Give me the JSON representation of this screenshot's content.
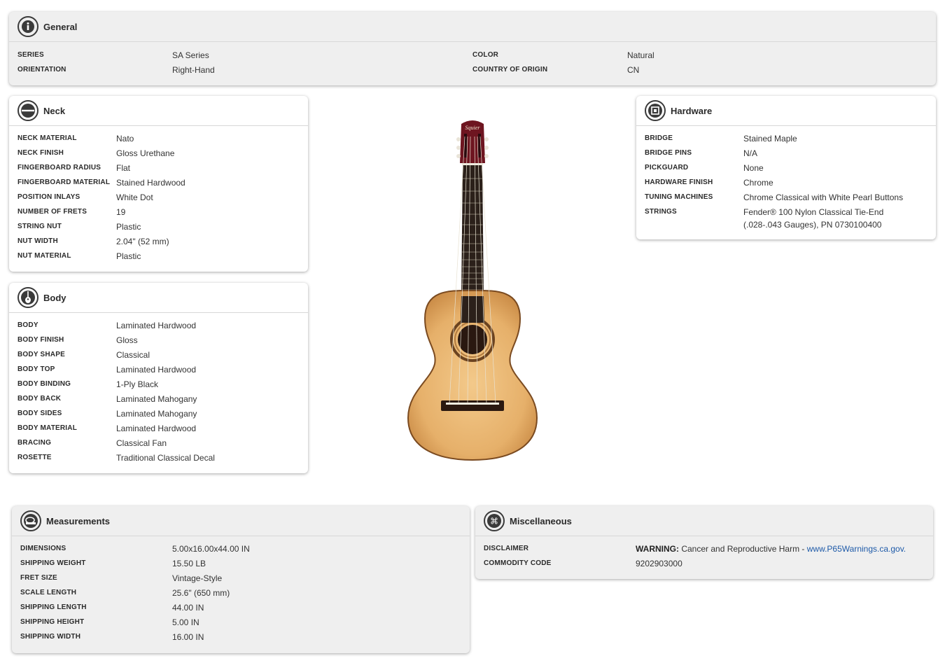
{
  "general": {
    "title": "General",
    "rows_left": [
      {
        "label": "SERIES",
        "value": "SA Series"
      },
      {
        "label": "ORIENTATION",
        "value": "Right-Hand"
      }
    ],
    "rows_right": [
      {
        "label": "COLOR",
        "value": "Natural"
      },
      {
        "label": "COUNTRY OF ORIGIN",
        "value": "CN"
      }
    ]
  },
  "neck": {
    "title": "Neck",
    "rows": [
      {
        "label": "NECK MATERIAL",
        "value": "Nato"
      },
      {
        "label": "NECK FINISH",
        "value": "Gloss Urethane"
      },
      {
        "label": "FINGERBOARD RADIUS",
        "value": "Flat"
      },
      {
        "label": "FINGERBOARD MATERIAL",
        "value": "Stained Hardwood"
      },
      {
        "label": "POSITION INLAYS",
        "value": "White Dot"
      },
      {
        "label": "NUMBER OF FRETS",
        "value": "19"
      },
      {
        "label": "STRING NUT",
        "value": "Plastic"
      },
      {
        "label": "NUT WIDTH",
        "value": "2.04\" (52 mm)"
      },
      {
        "label": "NUT MATERIAL",
        "value": "Plastic"
      }
    ]
  },
  "body": {
    "title": "Body",
    "rows": [
      {
        "label": "BODY",
        "value": "Laminated Hardwood"
      },
      {
        "label": "BODY FINISH",
        "value": "Gloss"
      },
      {
        "label": "BODY SHAPE",
        "value": "Classical"
      },
      {
        "label": "BODY TOP",
        "value": "Laminated Hardwood"
      },
      {
        "label": "BODY BINDING",
        "value": "1-Ply Black"
      },
      {
        "label": "BODY BACK",
        "value": "Laminated Mahogany"
      },
      {
        "label": "BODY SIDES",
        "value": "Laminated Mahogany"
      },
      {
        "label": "BODY MATERIAL",
        "value": "Laminated Hardwood"
      },
      {
        "label": "BRACING",
        "value": "Classical Fan"
      },
      {
        "label": "ROSETTE",
        "value": "Traditional Classical Decal"
      }
    ]
  },
  "hardware": {
    "title": "Hardware",
    "rows": [
      {
        "label": "BRIDGE",
        "value": "Stained Maple"
      },
      {
        "label": "BRIDGE PINS",
        "value": "N/A"
      },
      {
        "label": "PICKGUARD",
        "value": "None"
      },
      {
        "label": "HARDWARE FINISH",
        "value": "Chrome"
      },
      {
        "label": "TUNING MACHINES",
        "value": "Chrome Classical with White Pearl Buttons"
      },
      {
        "label": "STRINGS",
        "value": "Fender® 100 Nylon Classical Tie-End (.028-.043 Gauges), PN 0730100400"
      }
    ]
  },
  "measurements": {
    "title": "Measurements",
    "rows": [
      {
        "label": "DIMENSIONS",
        "value": "5.00x16.00x44.00 IN"
      },
      {
        "label": "SHIPPING WEIGHT",
        "value": "15.50 LB"
      },
      {
        "label": "FRET SIZE",
        "value": "Vintage-Style"
      },
      {
        "label": "SCALE LENGTH",
        "value": "25.6\" (650 mm)"
      },
      {
        "label": "SHIPPING LENGTH",
        "value": "44.00 IN"
      },
      {
        "label": "SHIPPING HEIGHT",
        "value": "5.00 IN"
      },
      {
        "label": "SHIPPING WIDTH",
        "value": "16.00 IN"
      }
    ]
  },
  "misc": {
    "title": "Miscellaneous",
    "disclaimer_label": "DISCLAIMER",
    "disclaimer_strong": "WARNING:",
    "disclaimer_text": " Cancer and Reproductive Harm - ",
    "disclaimer_link": "www.P65Warnings.ca.gov.",
    "commodity_label": "COMMODITY CODE",
    "commodity_value": "9202903000"
  },
  "guitar_logo": "Squier"
}
